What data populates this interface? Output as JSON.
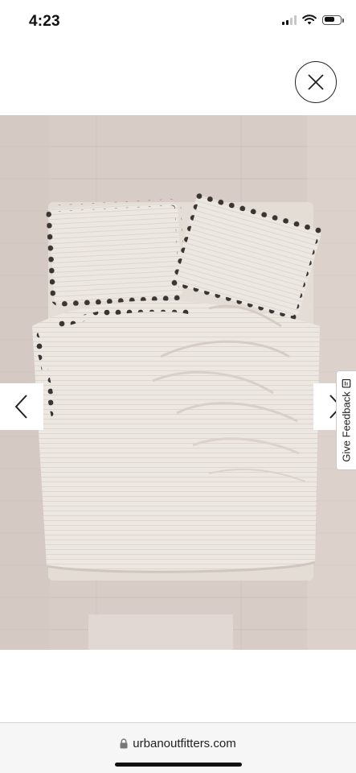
{
  "status_bar": {
    "time": "4:23",
    "icons": [
      "cellular-signal-icon",
      "wifi-icon",
      "battery-icon"
    ]
  },
  "close": {
    "icon": "close-icon"
  },
  "product_image": {
    "subject": "bed with white duvet and pom-pom trimmed pillows"
  },
  "carousel": {
    "prev_icon": "chevron-left-icon",
    "next_icon": "chevron-right-icon"
  },
  "feedback": {
    "label": "Give Feedback",
    "icon": "feedback-icon"
  },
  "browser": {
    "url": "urbanoutfitters.com",
    "lock_icon": "lock-icon"
  },
  "colors": {
    "background": "#ffffff",
    "floor": "#d8ccc6",
    "bedding": "#ece7e1",
    "pom_poms": "#3a3533"
  }
}
